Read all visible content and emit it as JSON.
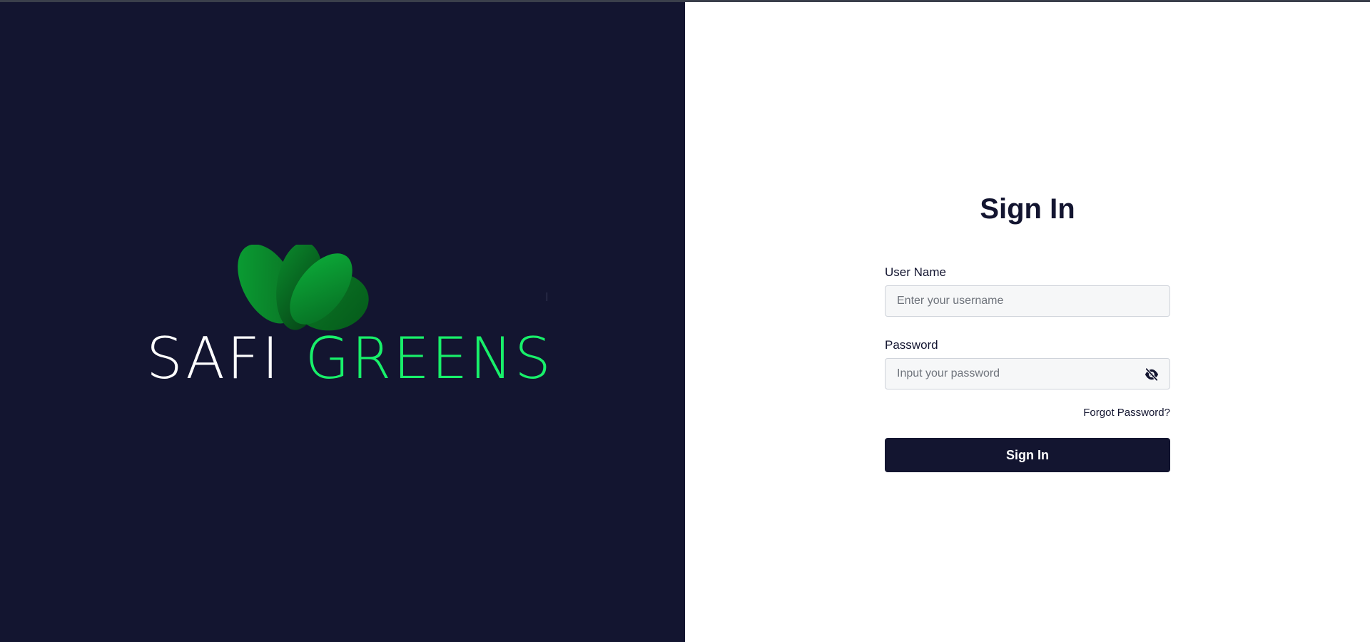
{
  "brand": {
    "word1": "SAFI",
    "word2": "GREENS",
    "colors": {
      "background": "#131530",
      "white_text": "#ffffff",
      "green_text": "#18f06a",
      "leaf_dark": "#0a5d1f",
      "leaf_light": "#0aa335"
    }
  },
  "form": {
    "title": "Sign In",
    "username": {
      "label": "User Name",
      "placeholder": "Enter your username",
      "value": ""
    },
    "password": {
      "label": "Password",
      "placeholder": "Input your password",
      "value": "",
      "toggle_icon": "eye-slash-icon"
    },
    "forgot_label": "Forgot Password?",
    "submit_label": "Sign In",
    "accent_color": "#131530"
  }
}
